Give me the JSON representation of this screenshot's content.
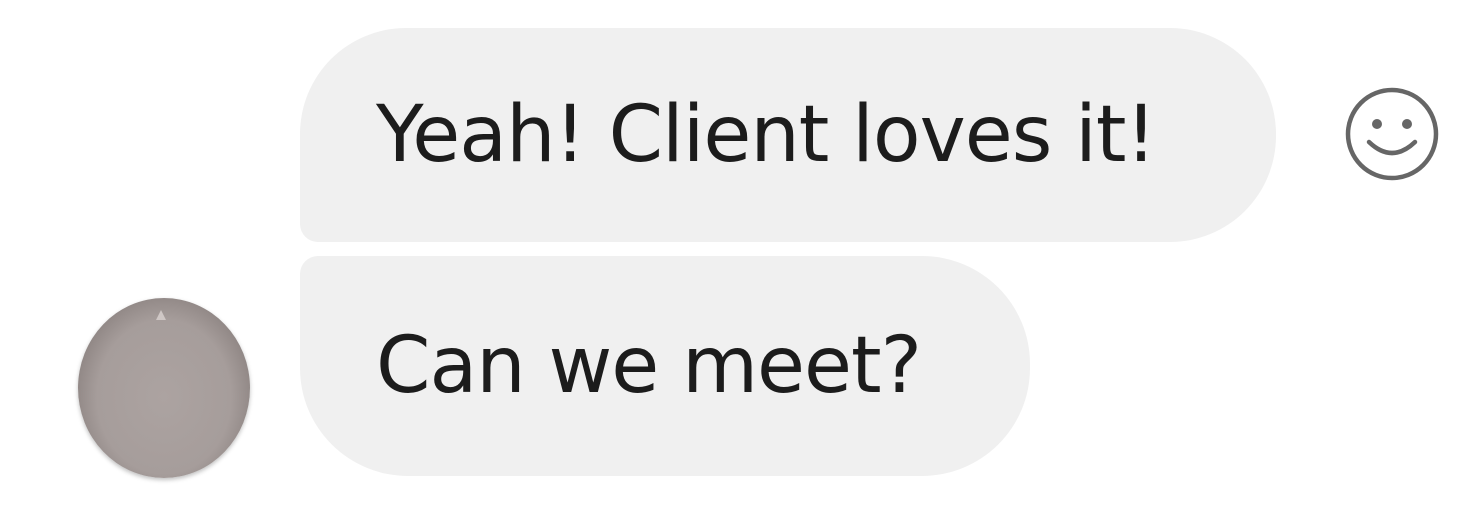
{
  "messages": [
    {
      "text": "Yeah! Client loves it!"
    },
    {
      "text": "Can we meet?"
    }
  ],
  "actions": {
    "react_icon": "smiley-face-icon"
  },
  "avatar": {
    "color": "#a69d9b"
  },
  "colors": {
    "bubble_bg": "#f0f0f0",
    "text": "#1c1c1c",
    "icon": "#666666"
  }
}
